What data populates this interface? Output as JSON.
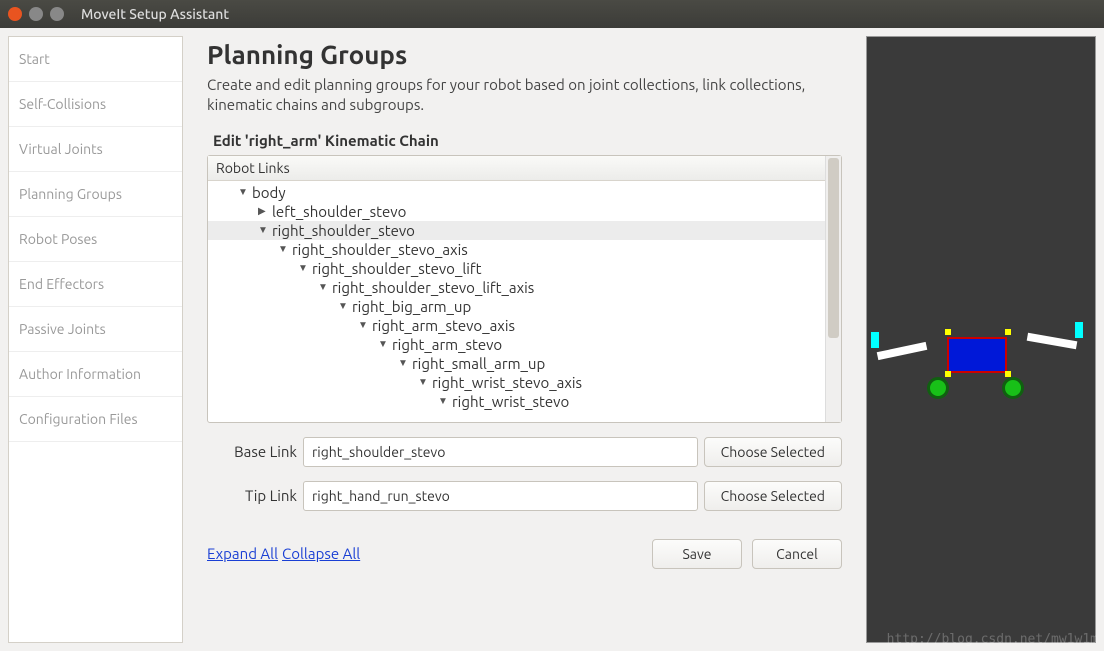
{
  "window": {
    "title": "MoveIt Setup Assistant"
  },
  "sidebar": {
    "items": [
      {
        "label": "Start"
      },
      {
        "label": "Self-Collisions"
      },
      {
        "label": "Virtual Joints"
      },
      {
        "label": "Planning Groups"
      },
      {
        "label": "Robot Poses"
      },
      {
        "label": "End Effectors"
      },
      {
        "label": "Passive Joints"
      },
      {
        "label": "Author Information"
      },
      {
        "label": "Configuration Files"
      }
    ]
  },
  "main": {
    "heading": "Planning Groups",
    "subtitle": "Create and edit planning groups for your robot based on joint collections, link collections, kinematic chains and subgroups.",
    "section_label": "Edit 'right_arm' Kinematic Chain",
    "tree_header": "Robot Links",
    "tree": [
      {
        "indent": 0,
        "arrow": "down",
        "label": "body",
        "selected": false
      },
      {
        "indent": 1,
        "arrow": "right",
        "label": "left_shoulder_stevo",
        "selected": false
      },
      {
        "indent": 1,
        "arrow": "down",
        "label": "right_shoulder_stevo",
        "selected": true
      },
      {
        "indent": 2,
        "arrow": "down",
        "label": "right_shoulder_stevo_axis",
        "selected": false
      },
      {
        "indent": 3,
        "arrow": "down",
        "label": "right_shoulder_stevo_lift",
        "selected": false
      },
      {
        "indent": 4,
        "arrow": "down",
        "label": "right_shoulder_stevo_lift_axis",
        "selected": false
      },
      {
        "indent": 5,
        "arrow": "down",
        "label": "right_big_arm_up",
        "selected": false
      },
      {
        "indent": 6,
        "arrow": "down",
        "label": "right_arm_stevo_axis",
        "selected": false
      },
      {
        "indent": 7,
        "arrow": "down",
        "label": "right_arm_stevo",
        "selected": false
      },
      {
        "indent": 8,
        "arrow": "down",
        "label": "right_small_arm_up",
        "selected": false
      },
      {
        "indent": 9,
        "arrow": "down",
        "label": "right_wrist_stevo_axis",
        "selected": false
      },
      {
        "indent": 10,
        "arrow": "down",
        "label": "right_wrist_stevo",
        "selected": false
      }
    ],
    "base_link_label": "Base Link",
    "base_link_value": "right_shoulder_stevo",
    "tip_link_label": "Tip Link",
    "tip_link_value": "right_hand_run_stevo",
    "choose_selected": "Choose Selected",
    "expand_all": "Expand All",
    "collapse_all": "Collapse All",
    "save": "Save",
    "cancel": "Cancel"
  },
  "watermark": "http://blog.csdn.net/mw1w1m"
}
